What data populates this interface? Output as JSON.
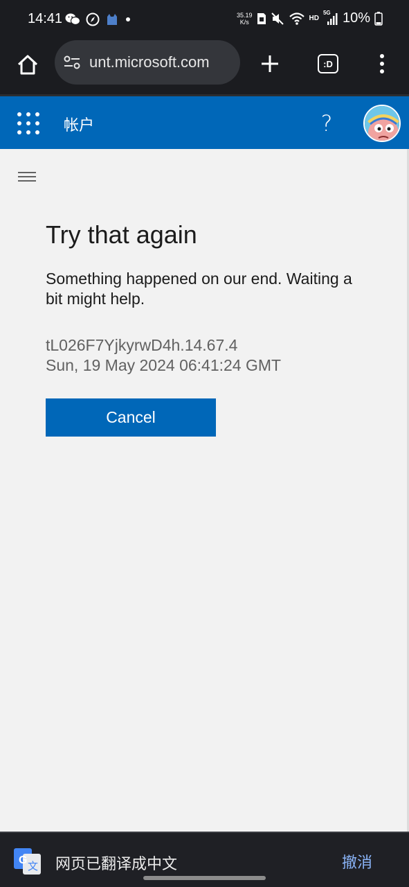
{
  "status_bar": {
    "time": "14:41",
    "net_speed_value": "35.19",
    "net_speed_unit": "K/s",
    "hd": "HD",
    "signal_type": "5G",
    "battery": "10%"
  },
  "browser": {
    "url": "unt.microsoft.com",
    "tabs_badge": ":D"
  },
  "header": {
    "title": "帐户",
    "help_label": "?"
  },
  "main": {
    "title": "Try that again",
    "message": "Something happened on our end. Waiting a bit might help.",
    "error_code": "tL026F7YjkyrwD4h.14.67.4",
    "error_time": "Sun, 19 May 2024 06:41:24 GMT",
    "cancel_label": "Cancel"
  },
  "translate_bar": {
    "message": "网页已翻译成中文",
    "undo_label": "撤消"
  },
  "colors": {
    "ms_blue": "#0067b8",
    "page_bg": "#f2f2f2",
    "browser_dark": "#1b1c20",
    "link_blue": "#8ab4f8"
  }
}
